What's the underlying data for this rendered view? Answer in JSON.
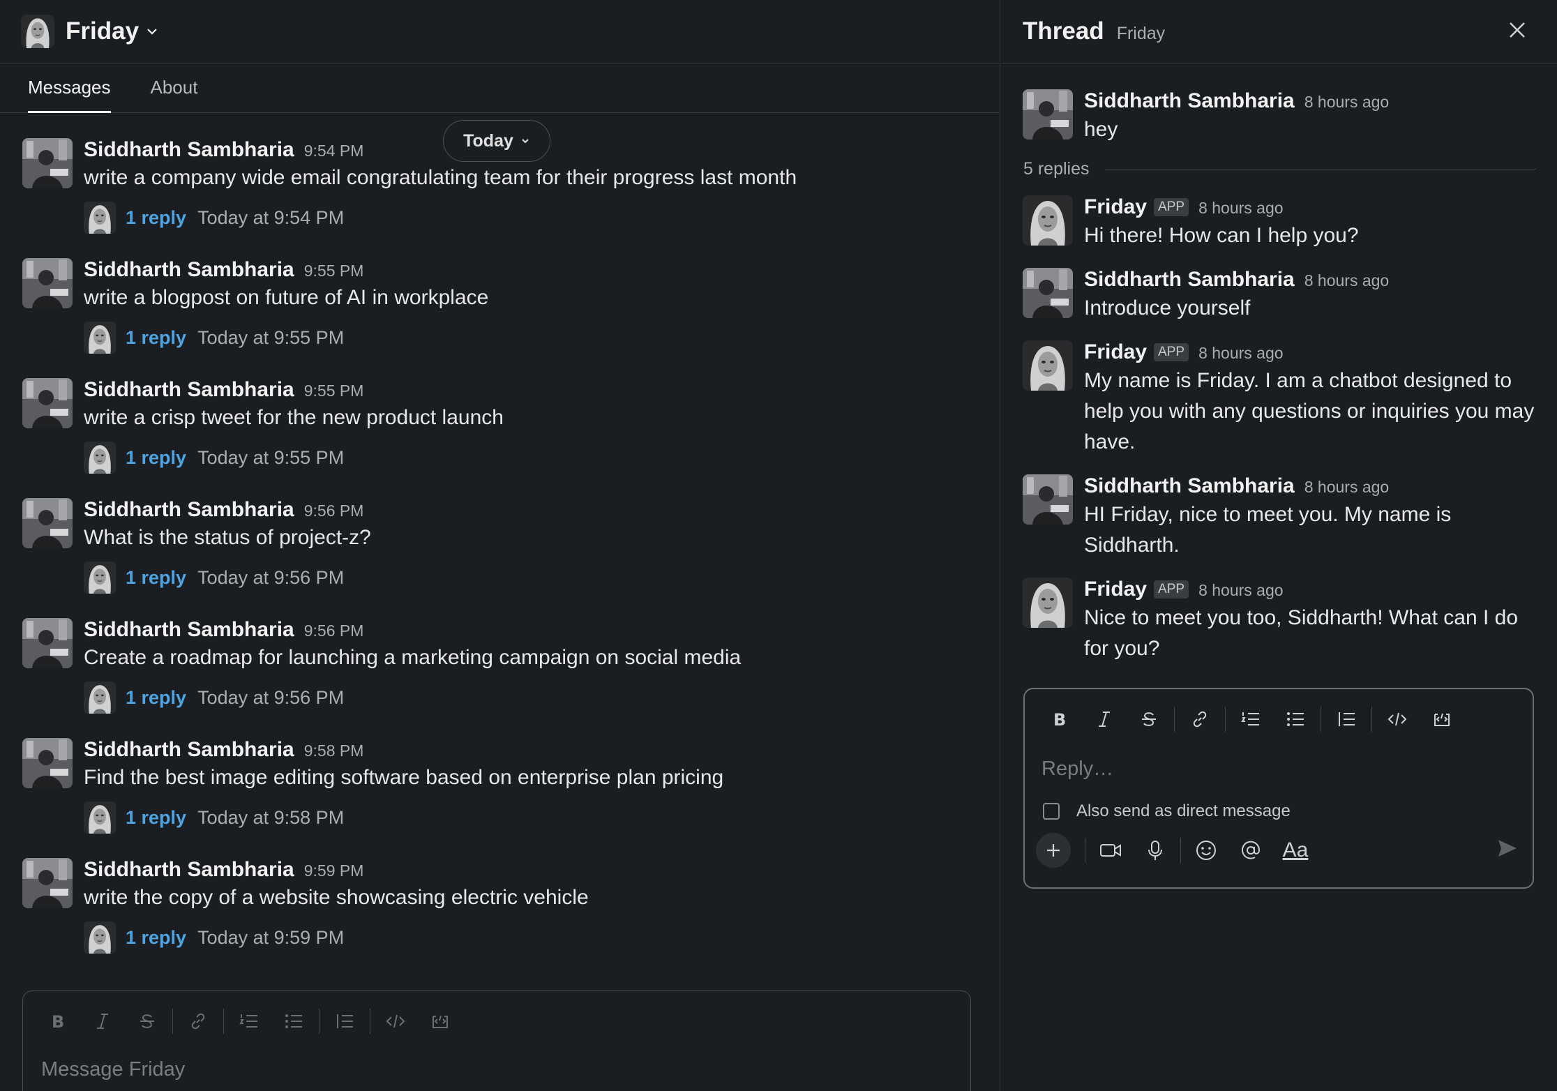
{
  "channel": {
    "name": "Friday"
  },
  "tabs": [
    {
      "label": "Messages"
    },
    {
      "label": "About"
    }
  ],
  "today_pill": "Today",
  "messages": [
    {
      "author": "Siddharth Sambharia",
      "time": "9:54 PM",
      "text": "write a company wide email congratulating team for their progress last month",
      "reply_link": "1 reply",
      "reply_when": "Today at 9:54 PM"
    },
    {
      "author": "Siddharth Sambharia",
      "time": "9:55 PM",
      "text": "write a blogpost on future of AI in workplace",
      "reply_link": "1 reply",
      "reply_when": "Today at 9:55 PM"
    },
    {
      "author": "Siddharth Sambharia",
      "time": "9:55 PM",
      "text": "write a crisp tweet for the new product launch",
      "reply_link": "1 reply",
      "reply_when": "Today at 9:55 PM"
    },
    {
      "author": "Siddharth Sambharia",
      "time": "9:56 PM",
      "text": "What is the status of project-z?",
      "reply_link": "1 reply",
      "reply_when": "Today at 9:56 PM"
    },
    {
      "author": "Siddharth Sambharia",
      "time": "9:56 PM",
      "text": "Create a roadmap for launching a marketing campaign on social media",
      "reply_link": "1 reply",
      "reply_when": "Today at 9:56 PM"
    },
    {
      "author": "Siddharth Sambharia",
      "time": "9:58 PM",
      "text": "Find the best image editing software based on enterprise plan pricing",
      "reply_link": "1 reply",
      "reply_when": "Today at 9:58 PM"
    },
    {
      "author": "Siddharth Sambharia",
      "time": "9:59 PM",
      "text": "write the copy of a website showcasing electric vehicle",
      "reply_link": "1 reply",
      "reply_when": "Today at 9:59 PM"
    }
  ],
  "composer": {
    "placeholder": "Message Friday"
  },
  "thread": {
    "title": "Thread",
    "subtitle": "Friday",
    "parent": {
      "author": "Siddharth Sambharia",
      "time": "8 hours ago",
      "text": "hey"
    },
    "replies_count": "5 replies",
    "replies": [
      {
        "author": "Friday",
        "badge": "APP",
        "time": "8 hours ago",
        "text": "Hi there! How can I help you?"
      },
      {
        "author": "Siddharth Sambharia",
        "time": "8 hours ago",
        "text": "Introduce yourself"
      },
      {
        "author": "Friday",
        "badge": "APP",
        "time": "8 hours ago",
        "text": "My name is Friday. I am a chatbot designed to help you with any questions or inquiries you may have."
      },
      {
        "author": "Siddharth Sambharia",
        "time": "8 hours ago",
        "text": "HI Friday, nice to meet you. My name is Siddharth."
      },
      {
        "author": "Friday",
        "badge": "APP",
        "time": "8 hours ago",
        "text": "Nice to meet you too, Siddharth! What can I do for you?"
      }
    ],
    "composer": {
      "placeholder": "Reply…",
      "dm_label": "Also send as direct message",
      "format_label": "Aa"
    }
  },
  "colors": {
    "background": "#1a1d21",
    "link": "#4fa3e0",
    "border": "#34373c"
  },
  "icons": [
    "chevron-down-icon",
    "close-icon",
    "bold-icon",
    "italic-icon",
    "strikethrough-icon",
    "link-icon",
    "ordered-list-icon",
    "bulleted-list-icon",
    "blockquote-icon",
    "code-icon",
    "code-block-icon",
    "plus-icon",
    "video-icon",
    "microphone-icon",
    "emoji-icon",
    "mention-icon",
    "send-icon"
  ]
}
